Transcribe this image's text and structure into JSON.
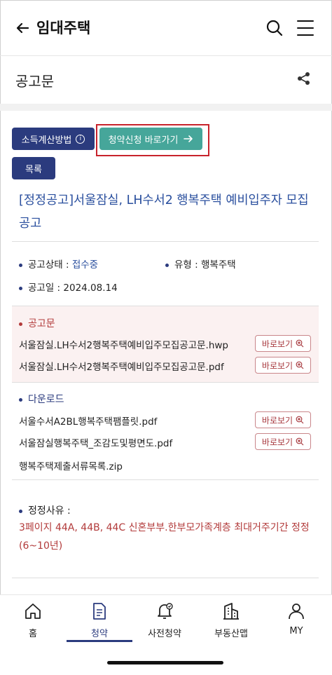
{
  "header": {
    "title": "임대주택"
  },
  "section": {
    "title": "공고문"
  },
  "buttons": {
    "income_calc": "소득계산방법",
    "apply_shortcut": "청약신청 바로가기",
    "list": "목록"
  },
  "notice": {
    "title": "[정정공고]서울잠실, LH수서2 행복주택 예비입주자 모집공고",
    "status_label": "공고상태 :",
    "status_value": "접수중",
    "type_label": "유형 :",
    "type_value": "행복주택",
    "date_label": "공고일 :",
    "date_value": "2024.08.14"
  },
  "announcement_files": {
    "heading": "공고문",
    "files": [
      {
        "name": "서울잠실.LH수서2행복주택예비입주모집공고문.hwp",
        "view_label": "바로보기"
      },
      {
        "name": "서울잠실.LH수서2행복주택예비입주모집공고문.pdf",
        "view_label": "바로보기"
      }
    ]
  },
  "downloads": {
    "heading": "다운로드",
    "files": [
      {
        "name": "서울수서A2BL행복주택팸플릿.pdf",
        "view_label": "바로보기"
      },
      {
        "name": "서울잠실행복주택_조감도및평면도.pdf",
        "view_label": "바로보기"
      },
      {
        "name": "행복주택제출서류목록.zip"
      }
    ]
  },
  "correction": {
    "label": "정정사유 :",
    "text": "3페이지 44A, 44B, 44C 신혼부부.한부모가족계층 최대거주기간 정정(6~10년)"
  },
  "bottom_nav": [
    {
      "label": "홈",
      "icon": "home-icon"
    },
    {
      "label": "청약",
      "icon": "document-icon",
      "active": true
    },
    {
      "label": "사전청약",
      "icon": "bell-check-icon"
    },
    {
      "label": "부동산맵",
      "icon": "building-map-icon"
    },
    {
      "label": "MY",
      "icon": "person-icon"
    }
  ],
  "colors": {
    "navy": "#2b3b7e",
    "teal": "#46a69a",
    "link_blue": "#2a4f9e",
    "red_text": "#b23a3a",
    "highlight_border": "#c8232c",
    "pink_bg": "#fbf1f1"
  }
}
